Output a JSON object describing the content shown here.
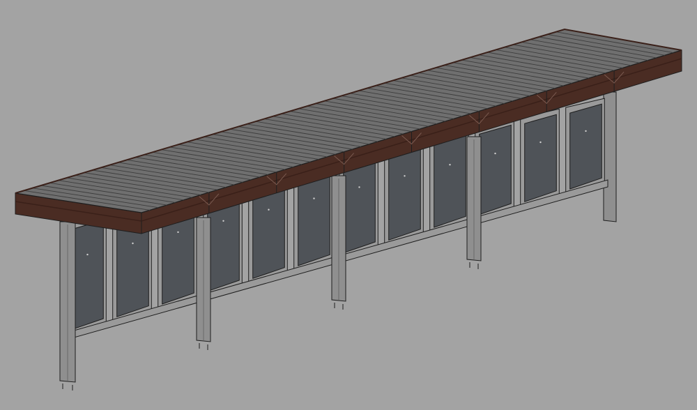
{
  "scene": {
    "subject": "bus-shelter-3d-model",
    "background_color": "#a3a3a3",
    "roof_deck_color": "#6f6f6f",
    "roof_slat_line_color": "#3d3d3d",
    "fascia_color": "#4a2c23",
    "fascia_dark_color": "#3a2019",
    "glass_panel_color": "#4f5358",
    "frame_color": "#9a9a9a",
    "post_color": "#8f8f8f",
    "outline_color": "#1e1e1e",
    "bays": 4,
    "panels_per_bay": 3,
    "roof_slats": 64
  }
}
